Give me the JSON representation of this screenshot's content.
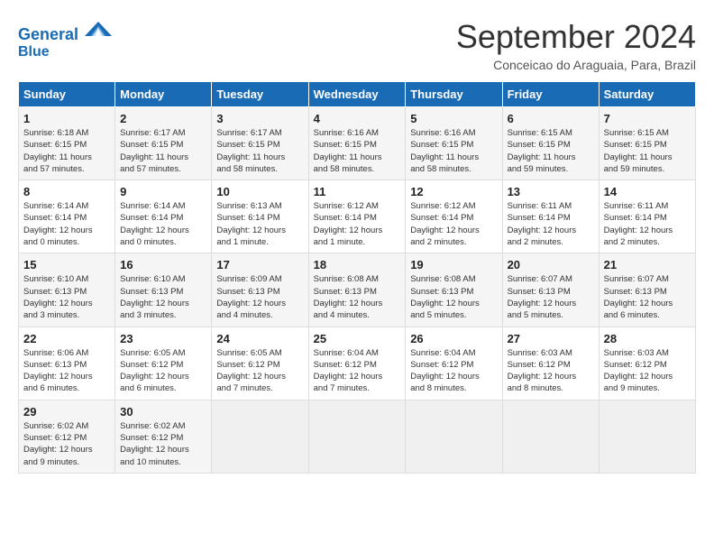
{
  "header": {
    "logo_line1": "General",
    "logo_line2": "Blue",
    "month": "September 2024",
    "location": "Conceicao do Araguaia, Para, Brazil"
  },
  "weekdays": [
    "Sunday",
    "Monday",
    "Tuesday",
    "Wednesday",
    "Thursday",
    "Friday",
    "Saturday"
  ],
  "weeks": [
    [
      {
        "day": 1,
        "info": "Sunrise: 6:18 AM\nSunset: 6:15 PM\nDaylight: 11 hours\nand 57 minutes."
      },
      {
        "day": 2,
        "info": "Sunrise: 6:17 AM\nSunset: 6:15 PM\nDaylight: 11 hours\nand 57 minutes."
      },
      {
        "day": 3,
        "info": "Sunrise: 6:17 AM\nSunset: 6:15 PM\nDaylight: 11 hours\nand 58 minutes."
      },
      {
        "day": 4,
        "info": "Sunrise: 6:16 AM\nSunset: 6:15 PM\nDaylight: 11 hours\nand 58 minutes."
      },
      {
        "day": 5,
        "info": "Sunrise: 6:16 AM\nSunset: 6:15 PM\nDaylight: 11 hours\nand 58 minutes."
      },
      {
        "day": 6,
        "info": "Sunrise: 6:15 AM\nSunset: 6:15 PM\nDaylight: 11 hours\nand 59 minutes."
      },
      {
        "day": 7,
        "info": "Sunrise: 6:15 AM\nSunset: 6:15 PM\nDaylight: 11 hours\nand 59 minutes."
      }
    ],
    [
      {
        "day": 8,
        "info": "Sunrise: 6:14 AM\nSunset: 6:14 PM\nDaylight: 12 hours\nand 0 minutes."
      },
      {
        "day": 9,
        "info": "Sunrise: 6:14 AM\nSunset: 6:14 PM\nDaylight: 12 hours\nand 0 minutes."
      },
      {
        "day": 10,
        "info": "Sunrise: 6:13 AM\nSunset: 6:14 PM\nDaylight: 12 hours\nand 1 minute."
      },
      {
        "day": 11,
        "info": "Sunrise: 6:12 AM\nSunset: 6:14 PM\nDaylight: 12 hours\nand 1 minute."
      },
      {
        "day": 12,
        "info": "Sunrise: 6:12 AM\nSunset: 6:14 PM\nDaylight: 12 hours\nand 2 minutes."
      },
      {
        "day": 13,
        "info": "Sunrise: 6:11 AM\nSunset: 6:14 PM\nDaylight: 12 hours\nand 2 minutes."
      },
      {
        "day": 14,
        "info": "Sunrise: 6:11 AM\nSunset: 6:14 PM\nDaylight: 12 hours\nand 2 minutes."
      }
    ],
    [
      {
        "day": 15,
        "info": "Sunrise: 6:10 AM\nSunset: 6:13 PM\nDaylight: 12 hours\nand 3 minutes."
      },
      {
        "day": 16,
        "info": "Sunrise: 6:10 AM\nSunset: 6:13 PM\nDaylight: 12 hours\nand 3 minutes."
      },
      {
        "day": 17,
        "info": "Sunrise: 6:09 AM\nSunset: 6:13 PM\nDaylight: 12 hours\nand 4 minutes."
      },
      {
        "day": 18,
        "info": "Sunrise: 6:08 AM\nSunset: 6:13 PM\nDaylight: 12 hours\nand 4 minutes."
      },
      {
        "day": 19,
        "info": "Sunrise: 6:08 AM\nSunset: 6:13 PM\nDaylight: 12 hours\nand 5 minutes."
      },
      {
        "day": 20,
        "info": "Sunrise: 6:07 AM\nSunset: 6:13 PM\nDaylight: 12 hours\nand 5 minutes."
      },
      {
        "day": 21,
        "info": "Sunrise: 6:07 AM\nSunset: 6:13 PM\nDaylight: 12 hours\nand 6 minutes."
      }
    ],
    [
      {
        "day": 22,
        "info": "Sunrise: 6:06 AM\nSunset: 6:13 PM\nDaylight: 12 hours\nand 6 minutes."
      },
      {
        "day": 23,
        "info": "Sunrise: 6:05 AM\nSunset: 6:12 PM\nDaylight: 12 hours\nand 6 minutes."
      },
      {
        "day": 24,
        "info": "Sunrise: 6:05 AM\nSunset: 6:12 PM\nDaylight: 12 hours\nand 7 minutes."
      },
      {
        "day": 25,
        "info": "Sunrise: 6:04 AM\nSunset: 6:12 PM\nDaylight: 12 hours\nand 7 minutes."
      },
      {
        "day": 26,
        "info": "Sunrise: 6:04 AM\nSunset: 6:12 PM\nDaylight: 12 hours\nand 8 minutes."
      },
      {
        "day": 27,
        "info": "Sunrise: 6:03 AM\nSunset: 6:12 PM\nDaylight: 12 hours\nand 8 minutes."
      },
      {
        "day": 28,
        "info": "Sunrise: 6:03 AM\nSunset: 6:12 PM\nDaylight: 12 hours\nand 9 minutes."
      }
    ],
    [
      {
        "day": 29,
        "info": "Sunrise: 6:02 AM\nSunset: 6:12 PM\nDaylight: 12 hours\nand 9 minutes."
      },
      {
        "day": 30,
        "info": "Sunrise: 6:02 AM\nSunset: 6:12 PM\nDaylight: 12 hours\nand 10 minutes."
      },
      null,
      null,
      null,
      null,
      null
    ]
  ]
}
